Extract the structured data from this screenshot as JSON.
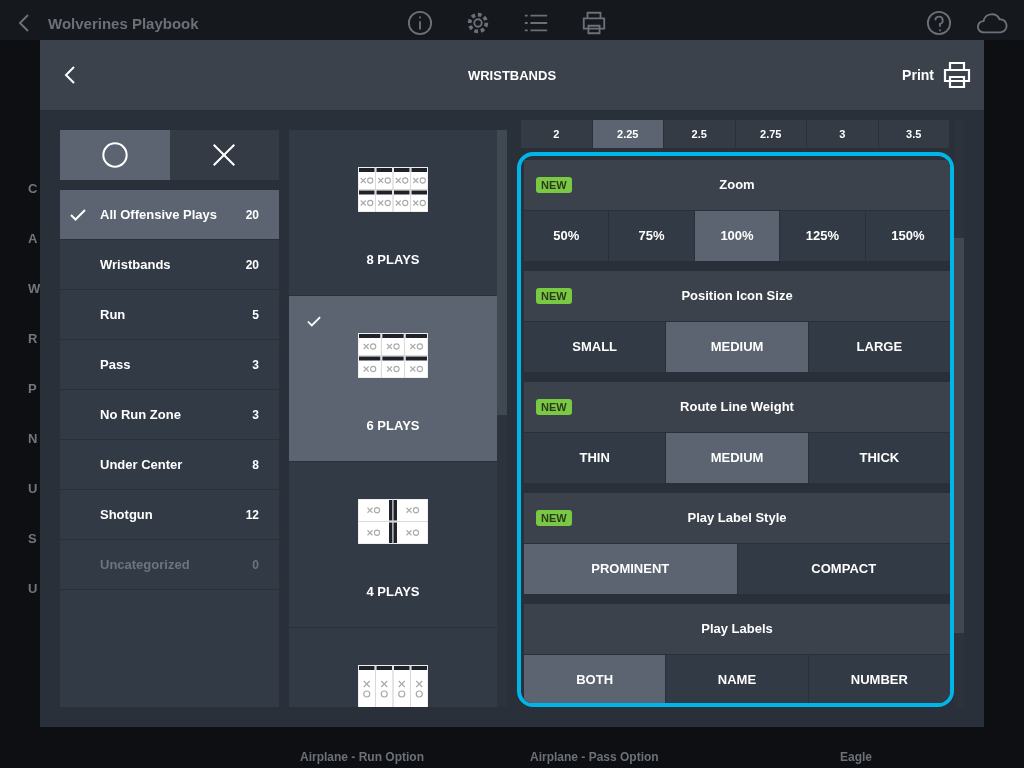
{
  "app": {
    "title": "Wolverines Playbook",
    "sidebar_fragments": [
      "C",
      "A",
      "W",
      "R",
      "P",
      "N",
      "U",
      "S",
      "U"
    ],
    "card_titles": [
      "Airplane - Run Option",
      "Airplane - Pass Option",
      "Eagle"
    ]
  },
  "dialog": {
    "title": "WRISTBANDS",
    "print_label": "Print"
  },
  "mode_toggle": [
    {
      "kind": "offense",
      "selected": true
    },
    {
      "kind": "defense",
      "selected": false
    }
  ],
  "categories": [
    {
      "label": "All Offensive Plays",
      "count": "20",
      "selected": true,
      "disabled": false
    },
    {
      "label": "Wristbands",
      "count": "20",
      "selected": false,
      "disabled": false
    },
    {
      "label": "Run",
      "count": "5",
      "selected": false,
      "disabled": false
    },
    {
      "label": "Pass",
      "count": "3",
      "selected": false,
      "disabled": false
    },
    {
      "label": "No Run Zone",
      "count": "3",
      "selected": false,
      "disabled": false
    },
    {
      "label": "Under Center",
      "count": "8",
      "selected": false,
      "disabled": false
    },
    {
      "label": "Shotgun",
      "count": "12",
      "selected": false,
      "disabled": false
    },
    {
      "label": "Uncategorized",
      "count": "0",
      "selected": false,
      "disabled": true
    }
  ],
  "layouts": [
    {
      "kind": "grid8",
      "label": "8 PLAYS",
      "selected": false
    },
    {
      "kind": "grid6",
      "label": "6 PLAYS",
      "selected": true
    },
    {
      "kind": "grid4",
      "label": "4 PLAYS",
      "selected": false
    },
    {
      "kind": "column4",
      "selected": false
    }
  ],
  "size_row": [
    {
      "label": "2",
      "selected": false
    },
    {
      "label": "2.25",
      "selected": true
    },
    {
      "label": "2.5",
      "selected": false
    },
    {
      "label": "2.75",
      "selected": false
    },
    {
      "label": "3",
      "selected": false
    },
    {
      "label": "3.5",
      "selected": false
    }
  ],
  "settings": [
    {
      "title": "Zoom",
      "new": true,
      "badge": "NEW",
      "options": [
        {
          "label": "50%",
          "selected": false
        },
        {
          "label": "75%",
          "selected": false
        },
        {
          "label": "100%",
          "selected": true
        },
        {
          "label": "125%",
          "selected": false
        },
        {
          "label": "150%",
          "selected": false
        }
      ]
    },
    {
      "title": "Position Icon Size",
      "new": true,
      "badge": "NEW",
      "options": [
        {
          "label": "SMALL",
          "selected": false
        },
        {
          "label": "MEDIUM",
          "selected": true
        },
        {
          "label": "LARGE",
          "selected": false
        }
      ]
    },
    {
      "title": "Route Line Weight",
      "new": true,
      "badge": "NEW",
      "options": [
        {
          "label": "THIN",
          "selected": false
        },
        {
          "label": "MEDIUM",
          "selected": true
        },
        {
          "label": "THICK",
          "selected": false
        }
      ]
    },
    {
      "title": "Play Label Style",
      "new": true,
      "badge": "NEW",
      "options": [
        {
          "label": "PROMINENT",
          "selected": true
        },
        {
          "label": "COMPACT",
          "selected": false
        }
      ]
    },
    {
      "title": "Play Labels",
      "new": false,
      "options": [
        {
          "label": "BOTH",
          "selected": true
        },
        {
          "label": "NAME",
          "selected": false
        },
        {
          "label": "NUMBER",
          "selected": false
        }
      ]
    }
  ]
}
